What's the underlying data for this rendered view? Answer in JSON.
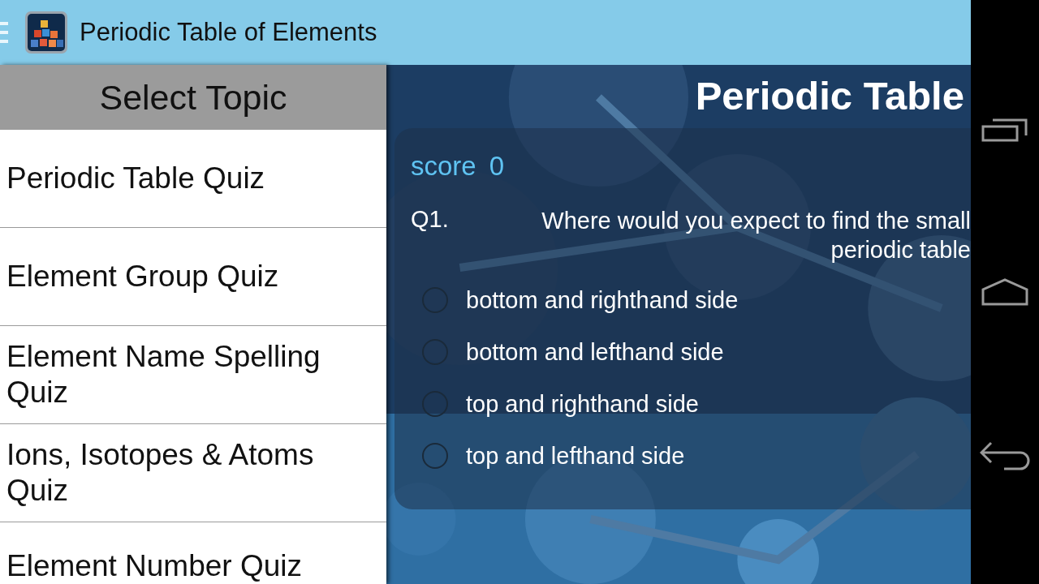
{
  "action_bar": {
    "title": "Periodic Table of Elements"
  },
  "drawer": {
    "header": "Select Topic",
    "items": [
      {
        "label": "Periodic Table Quiz",
        "selected": false
      },
      {
        "label": "Element Group Quiz",
        "selected": false
      },
      {
        "label": "Element Name Spelling Quiz",
        "selected": false
      },
      {
        "label": "Ions, Isotopes & Atoms Quiz",
        "selected": false
      },
      {
        "label": "Element Number Quiz",
        "selected": false
      }
    ]
  },
  "quiz": {
    "title": "Periodic Table",
    "score_label": "score",
    "score": "0",
    "question_number": "Q1.",
    "question": "Where would you expect to find the small periodic table",
    "options": [
      {
        "label": "bottom and righthand side",
        "selected": false
      },
      {
        "label": "bottom and lefthand side",
        "selected": false
      },
      {
        "label": "top and righthand side",
        "selected": false
      },
      {
        "label": "top and lefthand side",
        "selected": false
      }
    ]
  }
}
